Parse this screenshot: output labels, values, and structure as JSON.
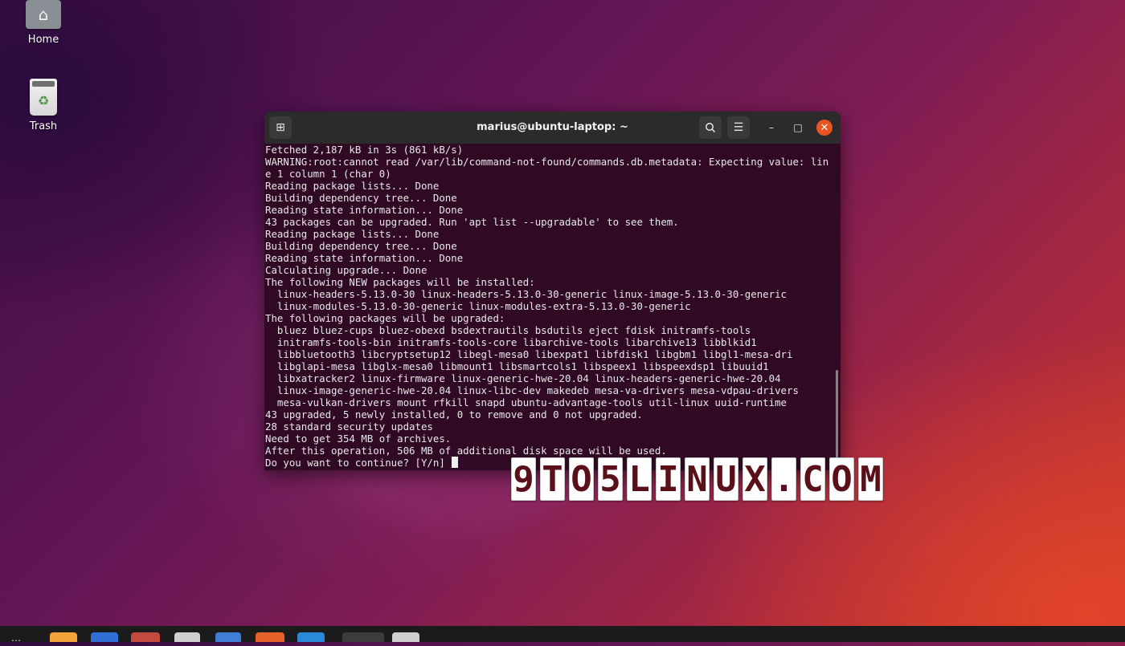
{
  "desktop": {
    "icons": [
      {
        "label": "Home",
        "icon": "home-folder-icon"
      },
      {
        "label": "Trash",
        "icon": "trash-icon"
      }
    ]
  },
  "terminal": {
    "title": "marius@ubuntu-laptop: ~",
    "new_tab_icon": "new-tab-icon",
    "search_icon": "search-icon",
    "menu_icon": "hamburger-menu-icon",
    "minimize_symbol": "–",
    "maximize_symbol": "□",
    "close_symbol": "✕",
    "lines": [
      "Fetched 2,187 kB in 3s (861 kB/s)",
      "WARNING:root:cannot read /var/lib/command-not-found/commands.db.metadata: Expecting value: lin",
      "e 1 column 1 (char 0)",
      "Reading package lists... Done",
      "Building dependency tree... Done",
      "Reading state information... Done",
      "43 packages can be upgraded. Run 'apt list --upgradable' to see them.",
      "Reading package lists... Done",
      "Building dependency tree... Done",
      "Reading state information... Done",
      "Calculating upgrade... Done",
      "The following NEW packages will be installed:",
      "  linux-headers-5.13.0-30 linux-headers-5.13.0-30-generic linux-image-5.13.0-30-generic",
      "  linux-modules-5.13.0-30-generic linux-modules-extra-5.13.0-30-generic",
      "The following packages will be upgraded:",
      "  bluez bluez-cups bluez-obexd bsdextrautils bsdutils eject fdisk initramfs-tools",
      "  initramfs-tools-bin initramfs-tools-core libarchive-tools libarchive13 libblkid1",
      "  libbluetooth3 libcryptsetup12 libegl-mesa0 libexpat1 libfdisk1 libgbm1 libgl1-mesa-dri",
      "  libglapi-mesa libglx-mesa0 libmount1 libsmartcols1 libspeex1 libspeexdsp1 libuuid1",
      "  libxatracker2 linux-firmware linux-generic-hwe-20.04 linux-headers-generic-hwe-20.04",
      "  linux-image-generic-hwe-20.04 linux-libc-dev makedeb mesa-va-drivers mesa-vdpau-drivers",
      "  mesa-vulkan-drivers mount rfkill snapd ubuntu-advantage-tools util-linux uuid-runtime",
      "43 upgraded, 5 newly installed, 0 to remove and 0 not upgraded.",
      "28 standard security updates",
      "Need to get 354 MB of archives.",
      "After this operation, 506 MB of additional disk space will be used."
    ],
    "prompt": "Do you want to continue? [Y/n] "
  },
  "watermark": {
    "text": "9TO5LINUX.COM",
    "letters": [
      "9",
      "T",
      "O",
      "5",
      "L",
      "I",
      "N",
      "U",
      "X",
      ".",
      "C",
      "O",
      "M"
    ]
  },
  "colors": {
    "terminal_bg": "#300a24",
    "titlebar_bg": "#2b2b2b",
    "close_button": "#e95420",
    "watermark_text": "#5a1018"
  }
}
